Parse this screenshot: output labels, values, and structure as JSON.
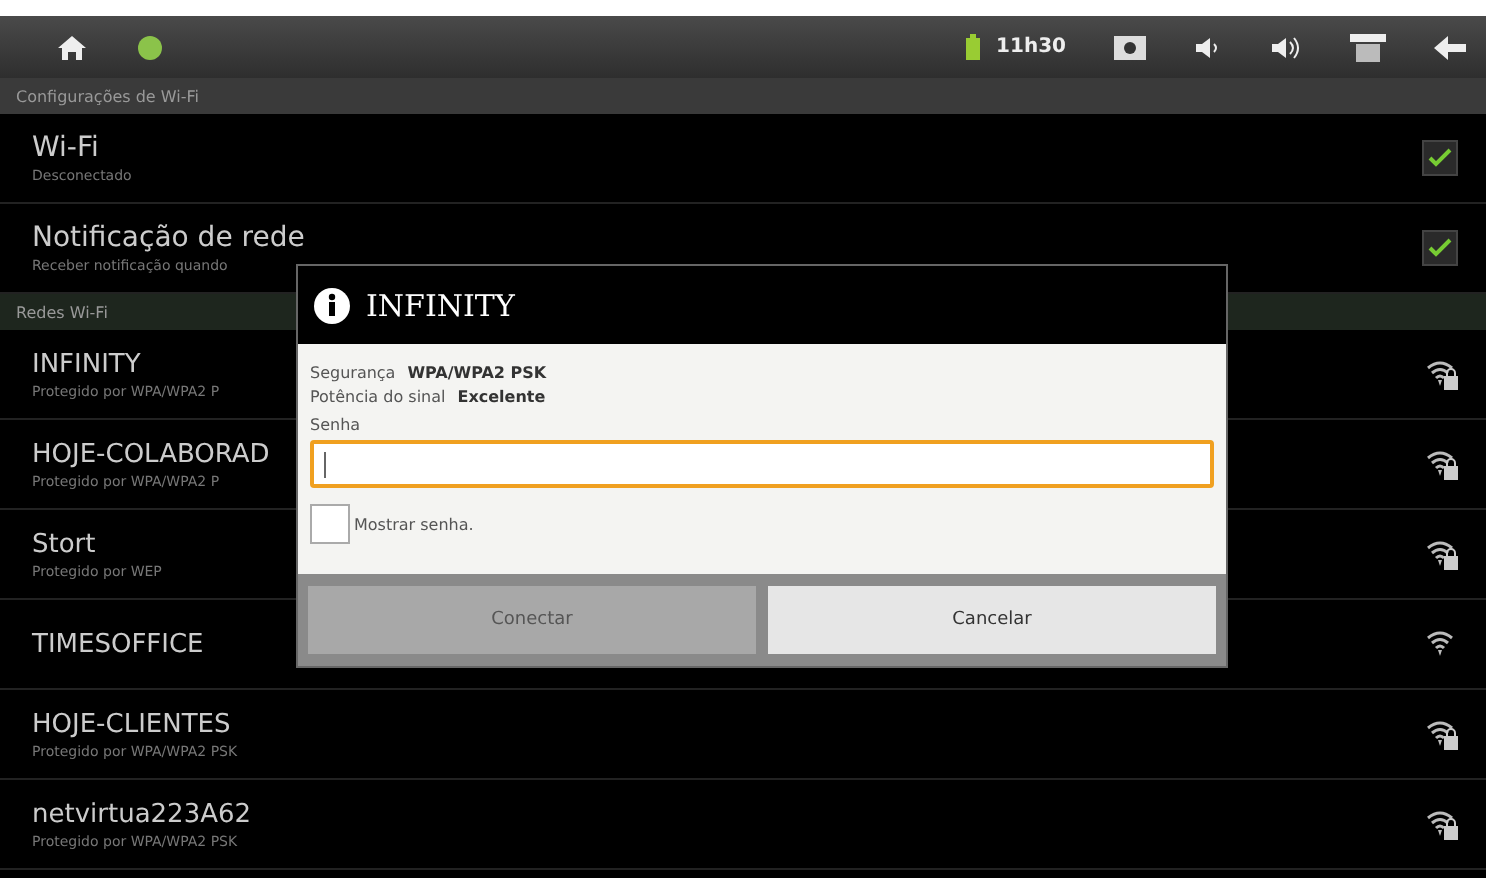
{
  "status_bar": {
    "time": "11h30"
  },
  "header": "Configurações de Wi-Fi",
  "settings": [
    {
      "title": "Wi-Fi",
      "subtitle": "Desconectado",
      "checked": true
    },
    {
      "title": "Notificação de rede",
      "subtitle": "Receber notificação quando",
      "checked": true
    }
  ],
  "networks_header": "Redes Wi-Fi",
  "networks": [
    {
      "name": "INFINITY",
      "subtitle": "Protegido por WPA/WPA2 P",
      "secured": true
    },
    {
      "name": "HOJE-COLABORAD",
      "subtitle": "Protegido por WPA/WPA2 P",
      "secured": true
    },
    {
      "name": "Stort",
      "subtitle": "Protegido por WEP",
      "secured": true
    },
    {
      "name": "TIMESOFFICE",
      "secured": false
    },
    {
      "name": "HOJE-CLIENTES",
      "subtitle": "Protegido por WPA/WPA2 PSK",
      "secured": true
    },
    {
      "name": "netvirtua223A62",
      "subtitle": "Protegido por WPA/WPA2 PSK",
      "secured": true
    }
  ],
  "dialog": {
    "title": "INFINITY",
    "details": [
      {
        "label": "Segurança",
        "value": "WPA/WPA2 PSK"
      },
      {
        "label": "Potência do sinal",
        "value": "Excelente"
      }
    ],
    "password_label": "Senha",
    "show_password": {
      "label": "Mostrar senha.",
      "checked": false
    },
    "buttons": [
      {
        "label": "Conectar",
        "disabled": true
      },
      {
        "label": "Cancelar",
        "disabled": false
      }
    ]
  }
}
